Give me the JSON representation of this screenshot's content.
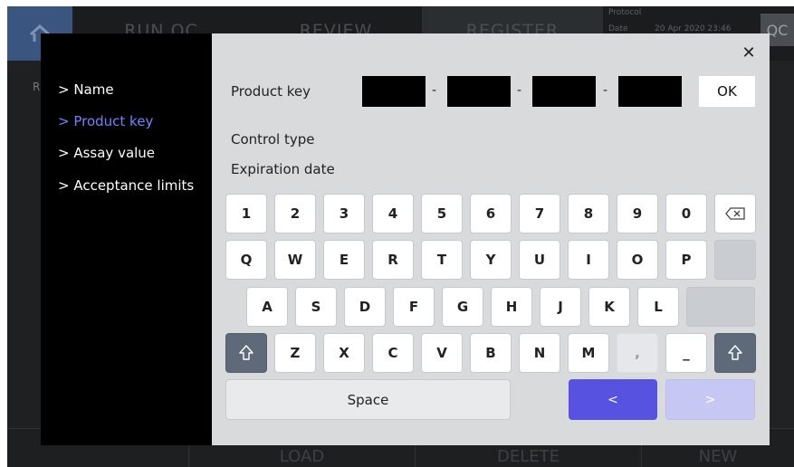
{
  "background": {
    "tabs": [
      "RUN QC",
      "REVIEW",
      "REGISTER"
    ],
    "protocol_label": "Protocol",
    "date_label": "Date",
    "date_value": "20 Apr 2020 23:46",
    "corner_label": "QC",
    "left_fragment": "R",
    "bottom_buttons": [
      "LOAD",
      "DELETE",
      "NEW"
    ]
  },
  "modal": {
    "nav_items": [
      "> Name",
      "> Product key",
      "> Assay value",
      "> Acceptance limits"
    ],
    "active_nav_index": 1,
    "product_key_label": "Product key",
    "product_key_separator": "-",
    "ok_label": "OK",
    "control_type_label": "Control type",
    "expiration_date_label": "Expiration date"
  },
  "keyboard": {
    "row1": [
      "1",
      "2",
      "3",
      "4",
      "5",
      "6",
      "7",
      "8",
      "9",
      "0"
    ],
    "row2": [
      "Q",
      "W",
      "E",
      "R",
      "T",
      "Y",
      "U",
      "I",
      "O",
      "P"
    ],
    "row3": [
      "A",
      "S",
      "D",
      "F",
      "G",
      "H",
      "J",
      "K",
      "L"
    ],
    "row4": [
      "Z",
      "X",
      "C",
      "V",
      "B",
      "N",
      "M",
      ",",
      "_"
    ],
    "space_label": "Space",
    "prev_label": "<",
    "next_label": ">"
  },
  "colors": {
    "accent_blue": "#5753e0",
    "active_nav": "#6f83ff",
    "next_disabled": "#c7c7f3"
  }
}
